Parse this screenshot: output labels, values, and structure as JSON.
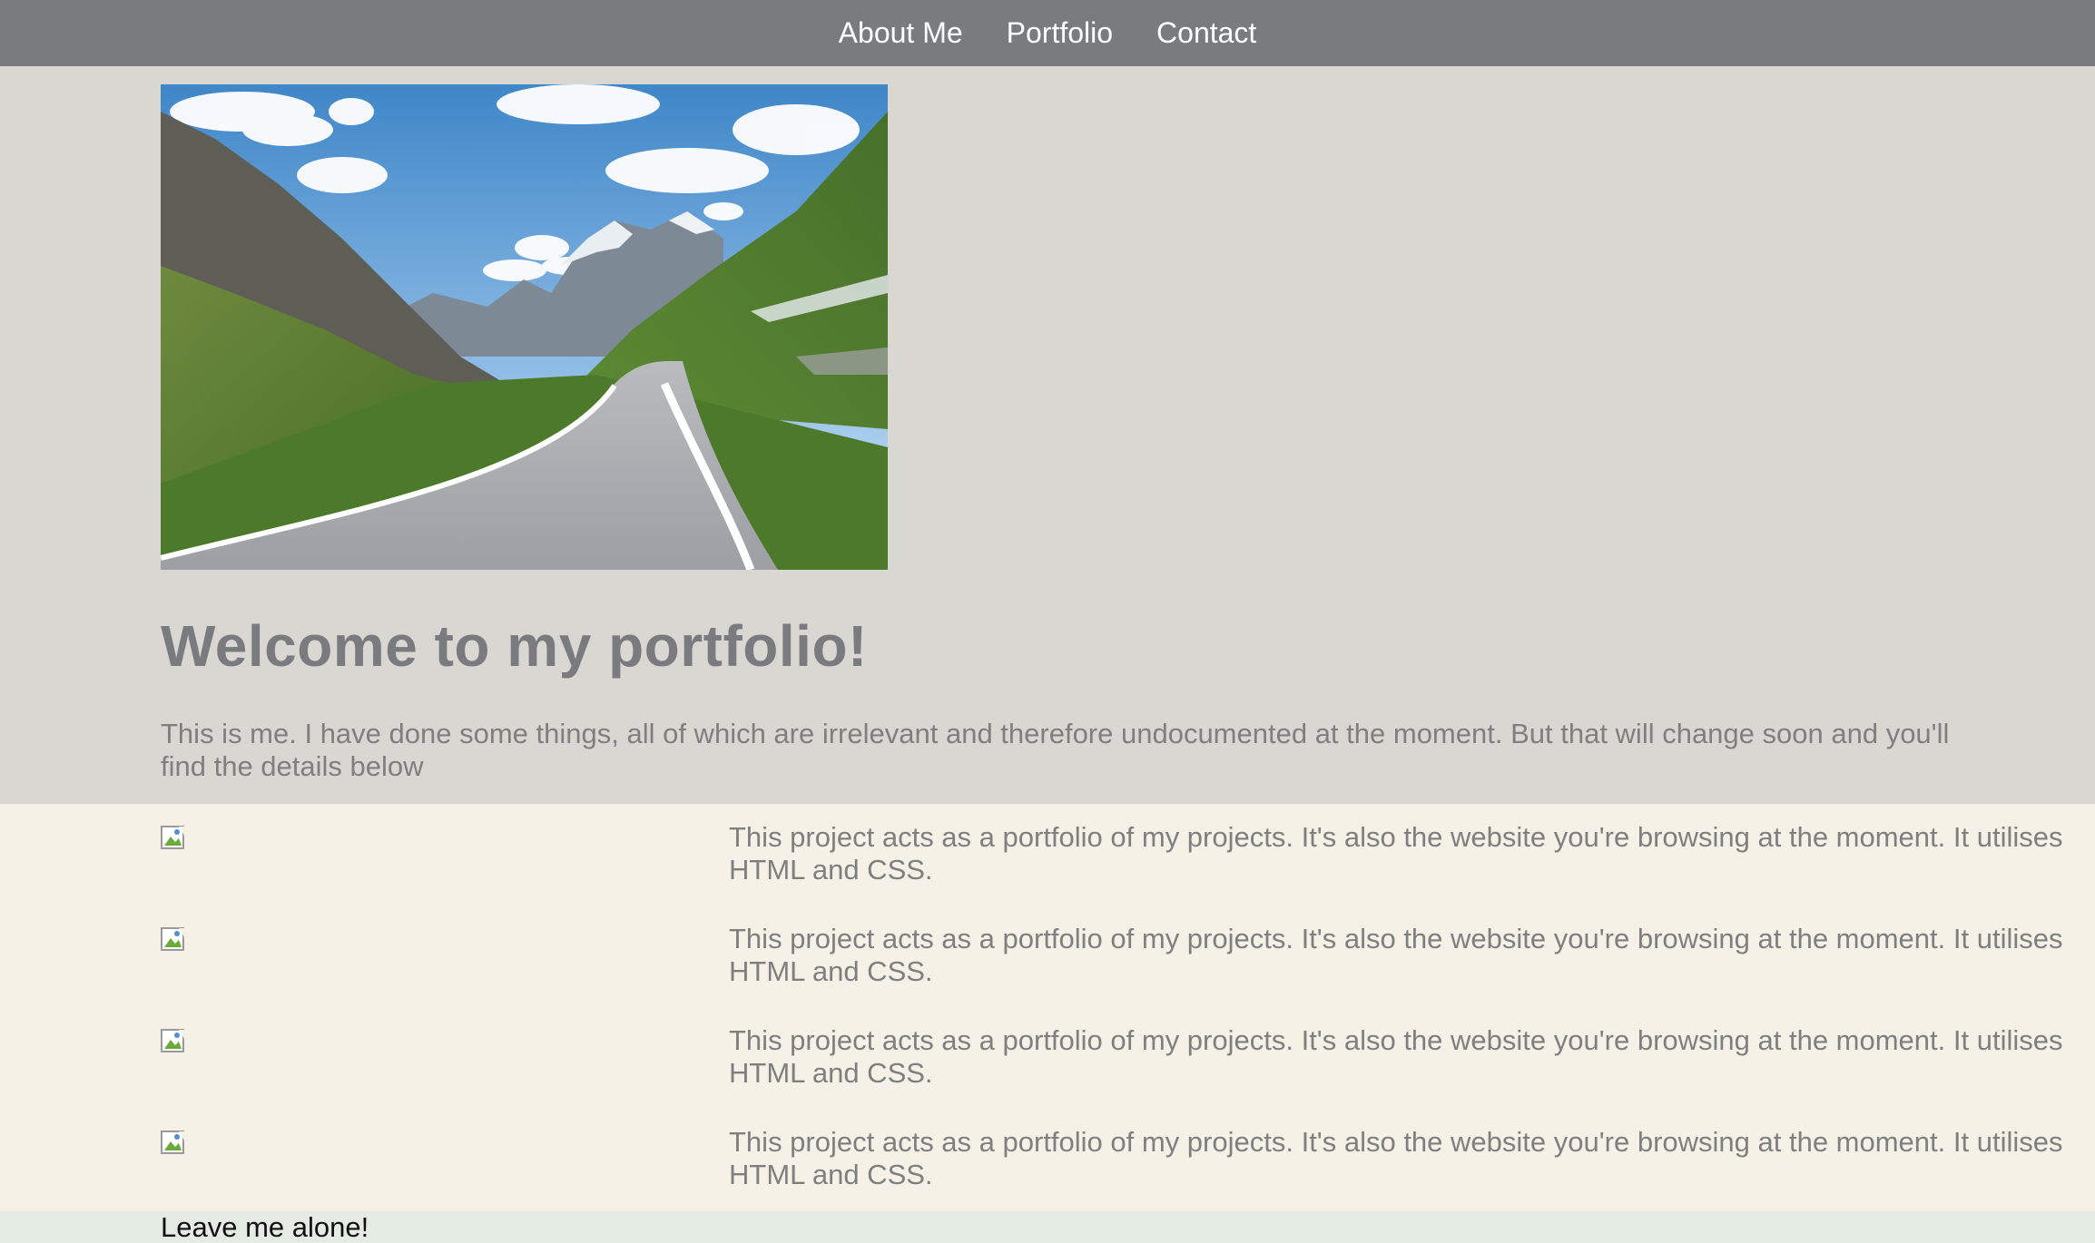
{
  "nav": {
    "items": [
      {
        "label": "About Me"
      },
      {
        "label": "Portfolio"
      },
      {
        "label": "Contact"
      }
    ]
  },
  "hero": {
    "title": "Welcome to my portfolio!",
    "text": "This is me. I have done some things, all of which are irrelevant and therefore undocumented at the moment. But that will change soon and you'll find the details below"
  },
  "projects": {
    "items": [
      {
        "description": "This project acts as a portfolio of my projects. It's also the website you're browsing at the moment. It utilises HTML and CSS."
      },
      {
        "description": "This project acts as a portfolio of my projects. It's also the website you're browsing at the moment. It utilises HTML and CSS."
      },
      {
        "description": "This project acts as a portfolio of my projects. It's also the website you're browsing at the moment. It utilises HTML and CSS."
      },
      {
        "description": "This project acts as a portfolio of my projects. It's also the website you're browsing at the moment. It utilises HTML and CSS."
      }
    ]
  },
  "footer": {
    "text": "Leave me alone!"
  },
  "colors": {
    "nav_bg": "#7a7b7f",
    "hero_bg": "#d9d7d2",
    "projects_bg": "#f5f1e6",
    "footer_bg": "#e4ebe3",
    "text_gray": "#7f7f80"
  }
}
